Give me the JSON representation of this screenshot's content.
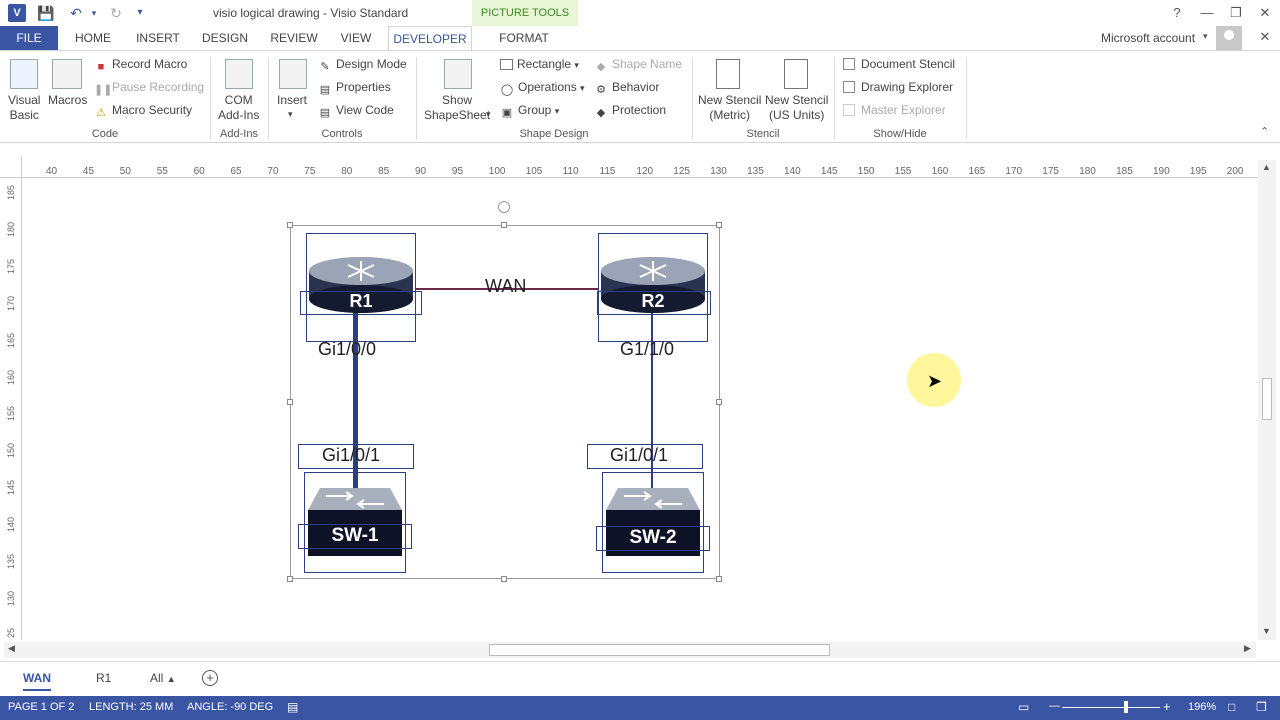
{
  "titlebar": {
    "app_icon": "V",
    "title": "visio logical drawing - Visio Standard",
    "context_tab": "PICTURE TOOLS"
  },
  "tabs": [
    "FILE",
    "HOME",
    "INSERT",
    "DESIGN",
    "REVIEW",
    "VIEW",
    "DEVELOPER",
    "FORMAT"
  ],
  "account": "Microsoft account",
  "ribbon": {
    "code": {
      "visual_basic": "Visual\nBasic",
      "macros": "Macros",
      "record_macro": "Record Macro",
      "pause_recording": "Pause Recording",
      "macro_security": "Macro Security",
      "label": "Code"
    },
    "addins": {
      "com": "COM\nAdd-Ins",
      "label": "Add-Ins"
    },
    "controls": {
      "insert": "Insert",
      "design_mode": "Design Mode",
      "properties": "Properties",
      "view_code": "View Code",
      "label": "Controls"
    },
    "shape_design": {
      "show_shapesheet": "Show\nShapeSheet",
      "rectangle": "Rectangle",
      "operations": "Operations",
      "group": "Group",
      "shape_name": "Shape Name",
      "behavior": "Behavior",
      "protection": "Protection",
      "label": "Shape Design"
    },
    "stencil": {
      "new_metric": "New Stencil\n(Metric)",
      "new_us": "New Stencil\n(US Units)",
      "label": "Stencil"
    },
    "showhide": {
      "document_stencil": "Document Stencil",
      "drawing_explorer": "Drawing Explorer",
      "master_explorer": "Master Explorer",
      "label": "Show/Hide"
    }
  },
  "hruler": [
    "40",
    "45",
    "50",
    "55",
    "60",
    "65",
    "70",
    "75",
    "80",
    "85",
    "90",
    "95",
    "100",
    "105",
    "110",
    "115",
    "120",
    "125",
    "130",
    "135",
    "140",
    "145",
    "150",
    "155",
    "160",
    "165",
    "170",
    "175",
    "180",
    "185",
    "190",
    "195",
    "200"
  ],
  "vruler": [
    "185",
    "180",
    "175",
    "170",
    "165",
    "160",
    "155",
    "150",
    "145",
    "140",
    "135",
    "130",
    "25"
  ],
  "drawing": {
    "r1": "R1",
    "r2": "R2",
    "wan": "WAN",
    "r1_port": "Gi1/0/0",
    "r2_port": "G1/1/0",
    "sw1_port": "Gi1/0/1",
    "sw2_port": "Gi1/0/1",
    "sw1": "SW-1",
    "sw2": "SW-2"
  },
  "page_tabs": [
    "WAN",
    "R1",
    "All"
  ],
  "status": {
    "page": "PAGE 1 OF 2",
    "length": "LENGTH: 25 MM",
    "angle": "ANGLE: -90 DEG",
    "zoom": "196%"
  },
  "colors": {
    "accent": "#3955a3",
    "picture_tools_bg": "#e8f5d6",
    "picture_tools_fg": "#3a8a21",
    "link_line": "#2b3e86",
    "wan_line": "#6b2a4a",
    "cursor_highlight": "#fff59a"
  }
}
